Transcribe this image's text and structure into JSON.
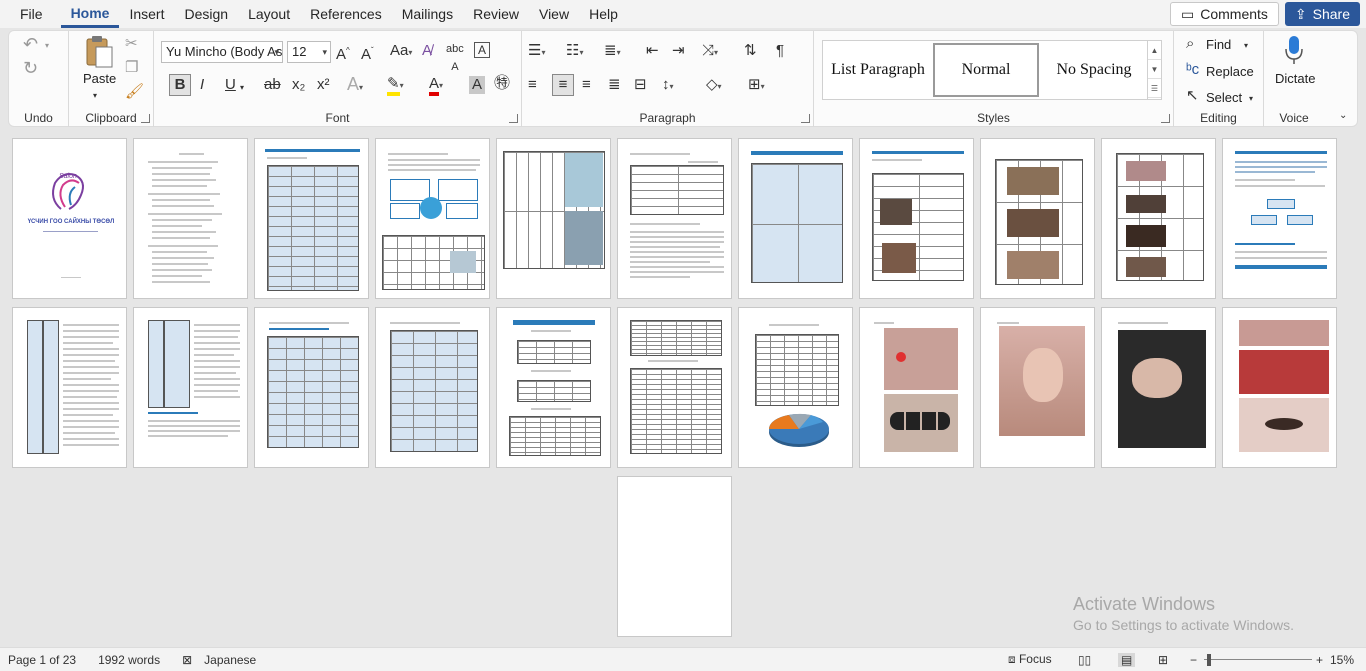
{
  "menu": {
    "tabs": [
      "File",
      "Home",
      "Insert",
      "Design",
      "Layout",
      "References",
      "Mailings",
      "Review",
      "View",
      "Help"
    ],
    "active": "Home",
    "comments_label": "Comments",
    "share_label": "Share"
  },
  "ribbon": {
    "undo": {
      "group_label": "Undo"
    },
    "clipboard": {
      "paste_label": "Paste",
      "group_label": "Clipboard"
    },
    "font": {
      "font_name": "Yu Mincho (Body As",
      "font_size": "12",
      "group_label": "Font",
      "bold": "B",
      "italic": "I",
      "underline": "U",
      "strike": "ab",
      "sub": "x₂",
      "sup": "x²",
      "grow": "A^",
      "shrink": "Aˇ",
      "case": "Aa",
      "clear": "A",
      "highlight": "ab",
      "color": "A",
      "shading": "A",
      "phonetic": "A",
      "charborder": "A"
    },
    "paragraph": {
      "group_label": "Paragraph"
    },
    "styles": {
      "items": [
        "List Paragraph",
        "Normal",
        "No Spacing"
      ],
      "selected": "Normal",
      "group_label": "Styles"
    },
    "editing": {
      "find": "Find",
      "replace": "Replace",
      "select": "Select",
      "group_label": "Editing"
    },
    "voice": {
      "dictate": "Dictate",
      "group_label": "Voice"
    }
  },
  "document": {
    "cover_title": "ҮСЧИН ГОО САЙХНЫ ТӨСӨЛ",
    "cover_logo": "Salon"
  },
  "watermark": {
    "line1": "Activate Windows",
    "line2": "Go to Settings to activate Windows."
  },
  "status": {
    "page": "Page 1 of 23",
    "words": "1992 words",
    "language": "Japanese",
    "focus": "Focus",
    "zoom": "15%"
  }
}
